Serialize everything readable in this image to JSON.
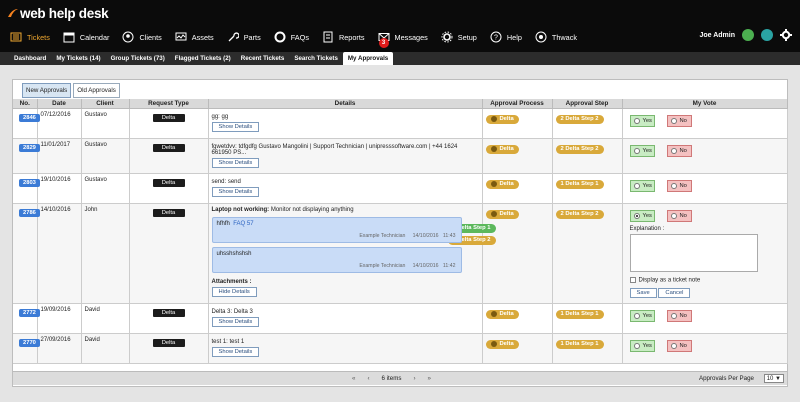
{
  "app": {
    "logo_text": "web help desk"
  },
  "nav": [
    {
      "label": "Tickets",
      "icon": "tickets-icon",
      "active": true
    },
    {
      "label": "Calendar",
      "icon": "calendar-icon"
    },
    {
      "label": "Clients",
      "icon": "clients-icon"
    },
    {
      "label": "Assets",
      "icon": "assets-icon"
    },
    {
      "label": "Parts",
      "icon": "parts-icon"
    },
    {
      "label": "FAQs",
      "icon": "faqs-icon"
    },
    {
      "label": "Reports",
      "icon": "reports-icon"
    },
    {
      "label": "Messages",
      "icon": "messages-icon",
      "badge": "3"
    },
    {
      "label": "Setup",
      "icon": "setup-icon"
    },
    {
      "label": "Help",
      "icon": "help-icon"
    },
    {
      "label": "Thwack",
      "icon": "thwack-icon"
    }
  ],
  "user": {
    "name": "Joe Admin"
  },
  "subnav": [
    "Dashboard",
    "My Tickets (14)",
    "Group Tickets (73)",
    "Flagged Tickets (2)",
    "Recent Tickets",
    "Search Tickets",
    "My Approvals"
  ],
  "approval_tabs": [
    "New Approvals",
    "Old Approvals"
  ],
  "columns": [
    "No.",
    "Date",
    "Client",
    "Request Type",
    "Details",
    "Approval Process",
    "Approval Step",
    "My Vote"
  ],
  "rows": [
    {
      "no": "2846",
      "date": "07/12/2016",
      "client": "Gustavo",
      "type": "Delta",
      "details": "gg: gg",
      "process": "Delta",
      "step": "2  Delta Step 2"
    },
    {
      "no": "2829",
      "date": "11/01/2017",
      "client": "Gustavo",
      "type": "Delta",
      "details": "fgwetdvv: tdfgdfg Gustavo Mangolini | Support Technician | unipresssoftware.com | +44 1624 661950 PS...",
      "process": "Delta",
      "step": "2  Delta Step 2"
    },
    {
      "no": "2803",
      "date": "19/10/2016",
      "client": "Gustavo",
      "type": "Delta",
      "details": "send: send",
      "process": "Delta",
      "step": "1  Delta Step 1"
    },
    {
      "no": "2786",
      "date": "14/10/2016",
      "client": "John",
      "type": "Delta",
      "details_title": "Laptop not working:",
      "details": "Monitor not displaying anything",
      "process": "Delta",
      "step": "2  Delta Step 2",
      "sub_steps": [
        "1  Delta Step 1",
        "2  Delta Step 2"
      ],
      "notes": [
        {
          "text": "hfhfh",
          "link": "FAQ 57",
          "author": "Example Technician",
          "date": "14/10/2016",
          "time": "11:43"
        },
        {
          "text": "uhsshshshsh",
          "author": "Example Technician",
          "date": "14/10/2016",
          "time": "11:42"
        }
      ],
      "attachments_label": "Attachments :",
      "hide_label": "Hide Details",
      "explanation_label": "Explanation :",
      "display_note_label": "Display as a ticket note",
      "save_label": "Save",
      "cancel_label": "Cancel"
    },
    {
      "no": "2772",
      "date": "19/09/2016",
      "client": "David",
      "type": "Delta",
      "details": "Delta 3: Delta 3",
      "process": "Delta",
      "step": "1  Delta Step 1"
    },
    {
      "no": "2770",
      "date": "27/09/2016",
      "client": "David",
      "type": "Delta",
      "details": "test 1: test 1",
      "process": "Delta",
      "step": "1  Delta Step 1"
    }
  ],
  "show_details_label": "Show Details",
  "vote": {
    "yes": "Yes",
    "no": "No"
  },
  "pager": {
    "count": "6 items",
    "per_page_label": "Approvals Per Page",
    "per_page_value": "10 ▼"
  }
}
